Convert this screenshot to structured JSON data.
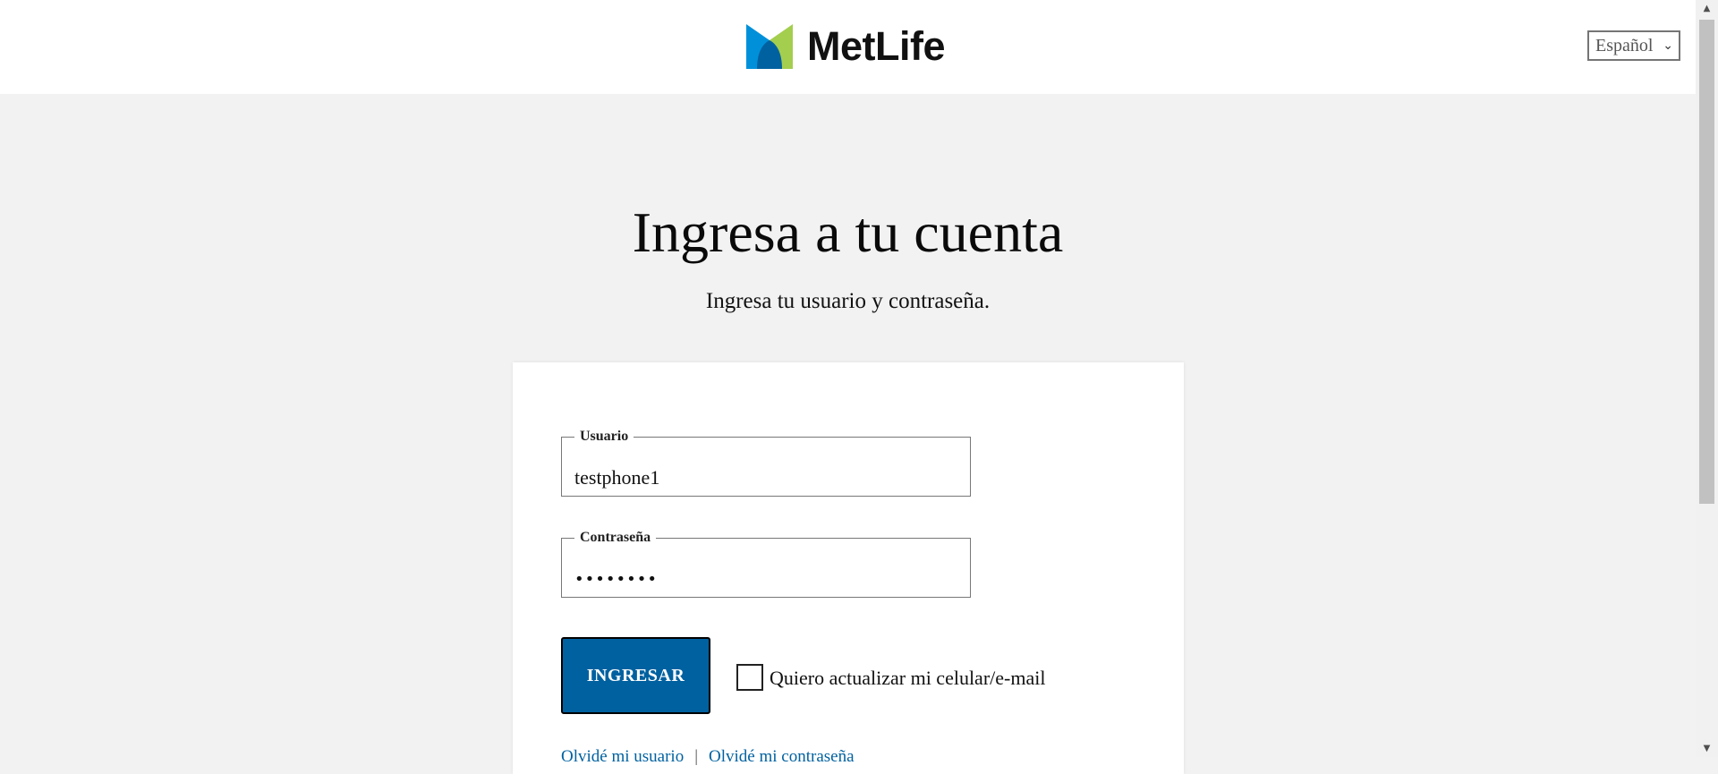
{
  "header": {
    "brand": "MetLife",
    "brand_colors": {
      "blue": "#0090da",
      "dark_blue": "#0061a0",
      "green": "#a4ce4e"
    },
    "language_selector": {
      "value": "Español",
      "icon": "chevron-down-icon"
    }
  },
  "main": {
    "title": "Ingresa a tu cuenta",
    "subtitle": "Ingresa tu usuario y contraseña."
  },
  "form": {
    "username": {
      "label": "Usuario",
      "value": "testphone1"
    },
    "password": {
      "label": "Contraseña",
      "value": "••••••••"
    },
    "submit_label": "INGRESAR",
    "update_checkbox": {
      "label": "Quiero actualizar mi celular/e-mail",
      "checked": false
    },
    "links": {
      "forgot_user": "Olvidé mi usuario",
      "separator": "|",
      "forgot_password": "Olvidé mi contraseña"
    }
  },
  "colors": {
    "accent": "#0061a0",
    "page_bg": "#f2f2f2",
    "card_bg": "#ffffff"
  }
}
